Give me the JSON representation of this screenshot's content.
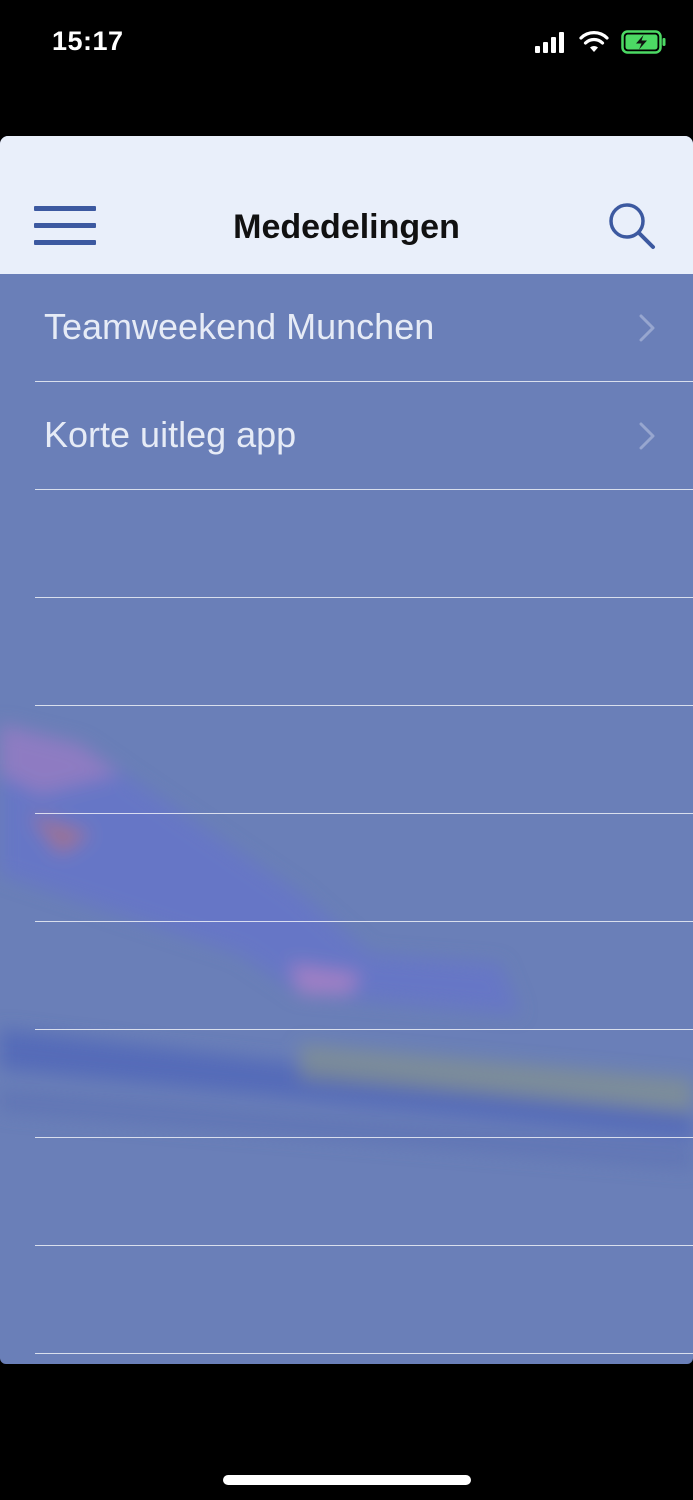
{
  "status_bar": {
    "time": "15:17"
  },
  "nav": {
    "title": "Mededelingen"
  },
  "announcements": [
    {
      "title": "Teamweekend Munchen"
    },
    {
      "title": "Korte uitleg app"
    }
  ],
  "colors": {
    "accent": "#3c59a0",
    "nav_background": "#e9effa",
    "list_overlay": "#6a7fb8",
    "battery": "#4cd964"
  }
}
